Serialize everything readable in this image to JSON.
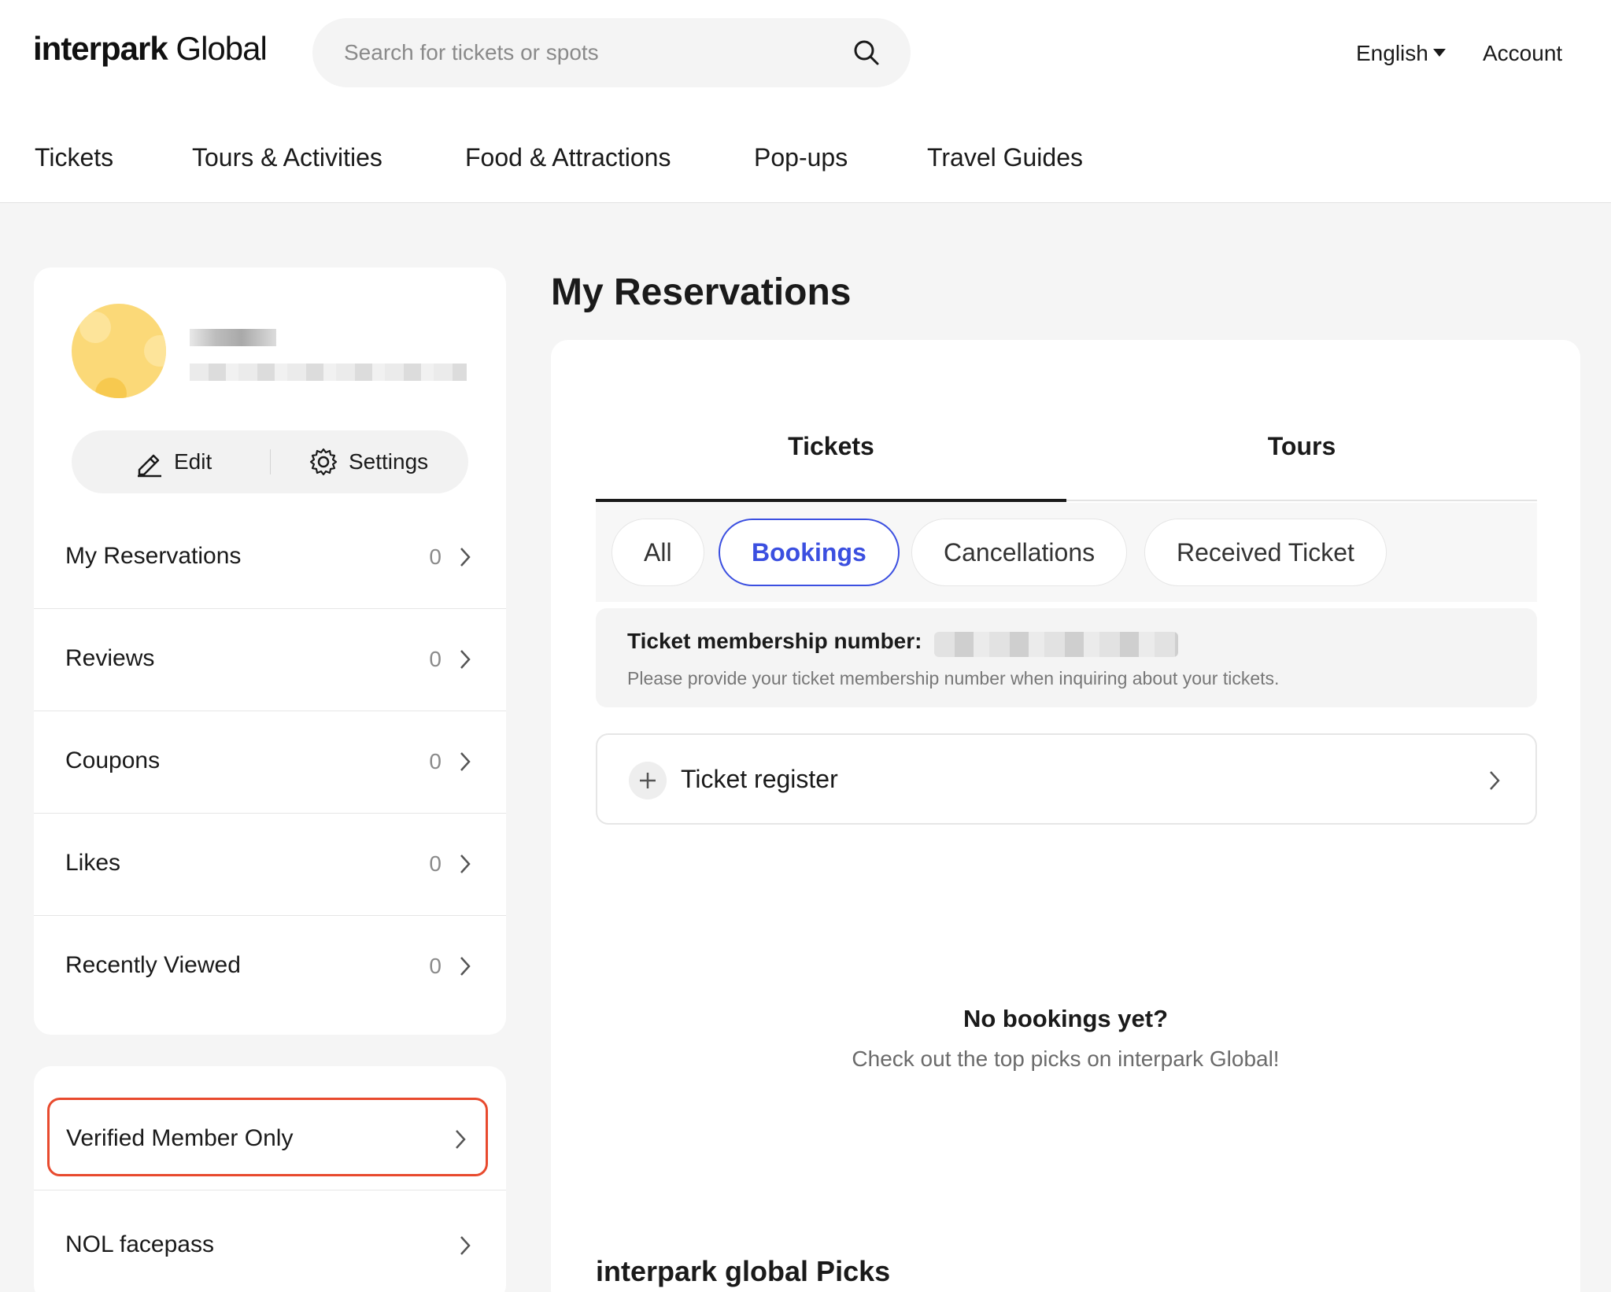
{
  "header": {
    "logo_bold": "interpark",
    "logo_light": "Global",
    "search_placeholder": "Search for tickets or spots",
    "language": "English",
    "account": "Account"
  },
  "nav": [
    "Tickets",
    "Tours & Activities",
    "Food & Attractions",
    "Pop-ups",
    "Travel Guides"
  ],
  "profile": {
    "edit_label": "Edit",
    "settings_label": "Settings",
    "menu": [
      {
        "label": "My Reservations",
        "count": "0"
      },
      {
        "label": "Reviews",
        "count": "0"
      },
      {
        "label": "Coupons",
        "count": "0"
      },
      {
        "label": "Likes",
        "count": "0"
      },
      {
        "label": "Recently Viewed",
        "count": "0"
      }
    ],
    "verified_label": "Verified Member Only",
    "nol_label": "NOL facepass"
  },
  "main": {
    "page_title": "My Reservations",
    "tabs": [
      "Tickets",
      "Tours"
    ],
    "filters": [
      "All",
      "Bookings",
      "Cancellations",
      "Received Ticket"
    ],
    "active_filter": "Bookings",
    "membership_title": "Ticket membership number:",
    "membership_desc": "Please provide your ticket membership number when inquiring about your tickets.",
    "register_label": "Ticket register",
    "empty_title": "No bookings yet?",
    "empty_sub": "Check out the top picks on interpark Global!",
    "picks_title": "interpark global Picks"
  },
  "colors": {
    "accent": "#3b4fe0",
    "highlight": "#e84a2e",
    "avatar": "#fbd978"
  }
}
